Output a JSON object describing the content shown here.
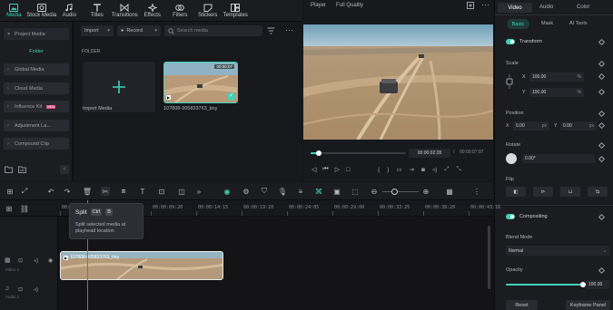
{
  "toolbar": {
    "items": [
      {
        "label": "Media",
        "icon": "media-icon",
        "active": true
      },
      {
        "label": "Stock Media",
        "icon": "stock-media-icon",
        "active": false
      },
      {
        "label": "Audio",
        "icon": "music-note-icon",
        "active": false
      },
      {
        "label": "Titles",
        "icon": "titles-icon",
        "active": false
      },
      {
        "label": "Transitions",
        "icon": "transitions-icon",
        "active": false
      },
      {
        "label": "Effects",
        "icon": "effects-icon",
        "active": false
      },
      {
        "label": "Filters",
        "icon": "filters-icon",
        "active": false
      },
      {
        "label": "Stickers",
        "icon": "stickers-icon",
        "active": false
      },
      {
        "label": "Templates",
        "icon": "templates-icon",
        "active": false
      }
    ]
  },
  "leftnav": {
    "project_media": "Project Media",
    "folder": "Folder",
    "items": [
      "Global Media",
      "Cloud Media",
      "Influence Kit",
      "Adjustment La...",
      "Compound Clip"
    ],
    "new_badge": "NEW"
  },
  "media": {
    "import_label": "Import",
    "record_label": "Record",
    "search_placeholder": "Search media",
    "folder_heading": "FOLDER",
    "import_tile_label": "Import Media",
    "clip_name": "107808-905833763_tiny",
    "clip_duration": "00:00:07"
  },
  "player": {
    "tab_player": "Player",
    "quality": "Full Quality",
    "current_time": "00:00:02:28",
    "separator": "/",
    "total_time": "00:00:07:07",
    "progress": 0.09
  },
  "rpanel": {
    "tabs": [
      "Video",
      "Audio",
      "Color"
    ],
    "subtabs": [
      "Basic",
      "Mask",
      "AI Tools"
    ],
    "transform": "Transform",
    "scale": "Scale",
    "x": "X",
    "y": "Y",
    "scale_x": "100.00",
    "scale_y": "100.00",
    "percent": "%",
    "position": "Position",
    "pos_x": "0.00",
    "pos_y": "0.00",
    "px": "px",
    "rotate": "Rotate",
    "rotate_val": "0.00°",
    "flip": "Flip",
    "compositing": "Compositing",
    "blend_mode": "Blend Mode",
    "blend_val": "Normal",
    "opacity": "Opacity",
    "opacity_val": "100.00",
    "reset": "Reset",
    "keyframe_panel": "Keyframe Panel",
    "accent": "#3fd2b6"
  },
  "timeline": {
    "ticks": [
      "00:00",
      "00:00:04:25",
      "00:00:09:20",
      "00:00:14:15",
      "00:00:19:10",
      "00:00:24:05",
      "00:00:29:00",
      "00:00:33:25",
      "00:00:38:20",
      "00:00:43:16"
    ],
    "video_track": "Video 1",
    "audio_track": "Audio 1",
    "clip_label": "107808-905833763_tiny",
    "playhead_color": "#e0455a"
  },
  "tooltip": {
    "title": "Split",
    "key1": "Ctrl",
    "key2": "B",
    "desc": "Split selected media at playhead location"
  }
}
